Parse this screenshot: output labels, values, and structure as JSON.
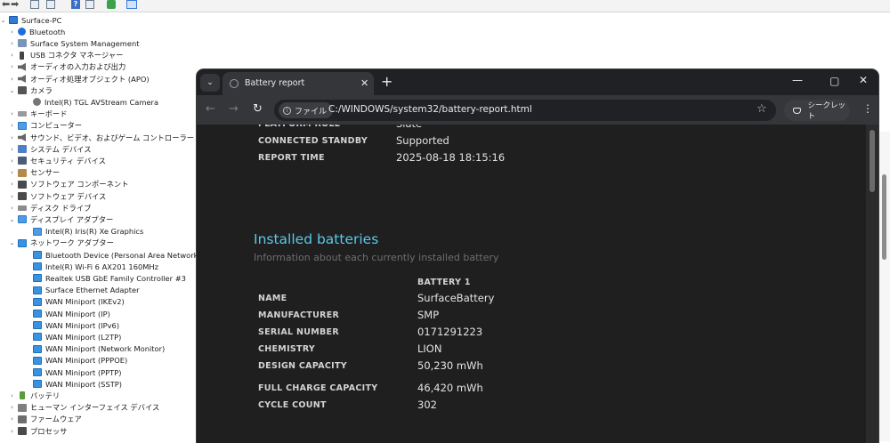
{
  "device_manager": {
    "root": "Surface-PC",
    "items": [
      {
        "label": "Bluetooth",
        "icon": "bluetooth-icon",
        "expanded": false
      },
      {
        "label": "Surface System Management",
        "icon": "system-management-icon",
        "expanded": false
      },
      {
        "label": "USB コネクタ マネージャー",
        "icon": "usb-connector-icon",
        "expanded": false
      },
      {
        "label": "オーディオの入力および出力",
        "icon": "speaker-icon",
        "expanded": false
      },
      {
        "label": "オーディオ処理オブジェクト (APO)",
        "icon": "speaker-icon",
        "expanded": false
      },
      {
        "label": "カメラ",
        "icon": "camera-icon",
        "expanded": true,
        "children": [
          "Intel(R) TGL AVStream Camera"
        ]
      },
      {
        "label": "キーボード",
        "icon": "keyboard-icon",
        "expanded": false
      },
      {
        "label": "コンピューター",
        "icon": "computer-icon",
        "expanded": false
      },
      {
        "label": "サウンド、ビデオ、およびゲーム コントローラー",
        "icon": "sound-icon",
        "expanded": false
      },
      {
        "label": "システム デバイス",
        "icon": "system-devices-icon",
        "expanded": false
      },
      {
        "label": "セキュリティ デバイス",
        "icon": "security-device-icon",
        "expanded": false
      },
      {
        "label": "センサー",
        "icon": "sensor-icon",
        "expanded": false
      },
      {
        "label": "ソフトウェア コンポーネント",
        "icon": "software-component-icon",
        "expanded": false
      },
      {
        "label": "ソフトウェア デバイス",
        "icon": "software-device-icon",
        "expanded": false
      },
      {
        "label": "ディスク ドライブ",
        "icon": "disk-drive-icon",
        "expanded": false
      },
      {
        "label": "ディスプレイ アダプター",
        "icon": "display-adapter-icon",
        "expanded": true,
        "children": [
          "Intel(R) Iris(R) Xe Graphics"
        ]
      },
      {
        "label": "ネットワーク アダプター",
        "icon": "network-adapter-icon",
        "expanded": true,
        "children": [
          "Bluetooth Device (Personal Area Network)",
          "Intel(R) Wi-Fi 6 AX201 160MHz",
          "Realtek USB GbE Family Controller #3",
          "Surface Ethernet Adapter",
          "WAN Miniport (IKEv2)",
          "WAN Miniport (IP)",
          "WAN Miniport (IPv6)",
          "WAN Miniport (L2TP)",
          "WAN Miniport (Network Monitor)",
          "WAN Miniport (PPPOE)",
          "WAN Miniport (PPTP)",
          "WAN Miniport (SSTP)"
        ]
      },
      {
        "label": "バッテリ",
        "icon": "battery-icon",
        "expanded": false
      },
      {
        "label": "ヒューマン インターフェイス デバイス",
        "icon": "hid-icon",
        "expanded": false
      },
      {
        "label": "ファームウェア",
        "icon": "firmware-icon",
        "expanded": false
      },
      {
        "label": "プロセッサ",
        "icon": "processor-icon",
        "expanded": false
      }
    ]
  },
  "browser": {
    "tab_title": "Battery report",
    "chip_label": "ファイル",
    "url": "C:/WINDOWS/system32/battery-report.html",
    "incognito_label": "シークレット"
  },
  "report": {
    "system_rows": [
      {
        "label": "PLATFORM ROLE",
        "value": "Slate"
      },
      {
        "label": "CONNECTED STANDBY",
        "value": "Supported"
      },
      {
        "label": "REPORT TIME",
        "value": "2025-08-18  18:15:16"
      }
    ],
    "batteries_heading": "Installed batteries",
    "batteries_subheading": "Information about each currently installed battery",
    "battery_column": "BATTERY 1",
    "battery_rows": [
      {
        "label": "NAME",
        "value": "SurfaceBattery"
      },
      {
        "label": "MANUFACTURER",
        "value": "SMP"
      },
      {
        "label": "SERIAL NUMBER",
        "value": "0171291223"
      },
      {
        "label": "CHEMISTRY",
        "value": "LION"
      },
      {
        "label": "DESIGN CAPACITY",
        "value": "50,230 mWh"
      },
      {
        "label": "FULL CHARGE CAPACITY",
        "value": "46,420 mWh"
      },
      {
        "label": "CYCLE COUNT",
        "value": "302"
      }
    ]
  },
  "colors": {
    "heading_accent": "#5bc8ea",
    "page_background": "#1f1f1f",
    "chrome_frame": "#202124"
  }
}
